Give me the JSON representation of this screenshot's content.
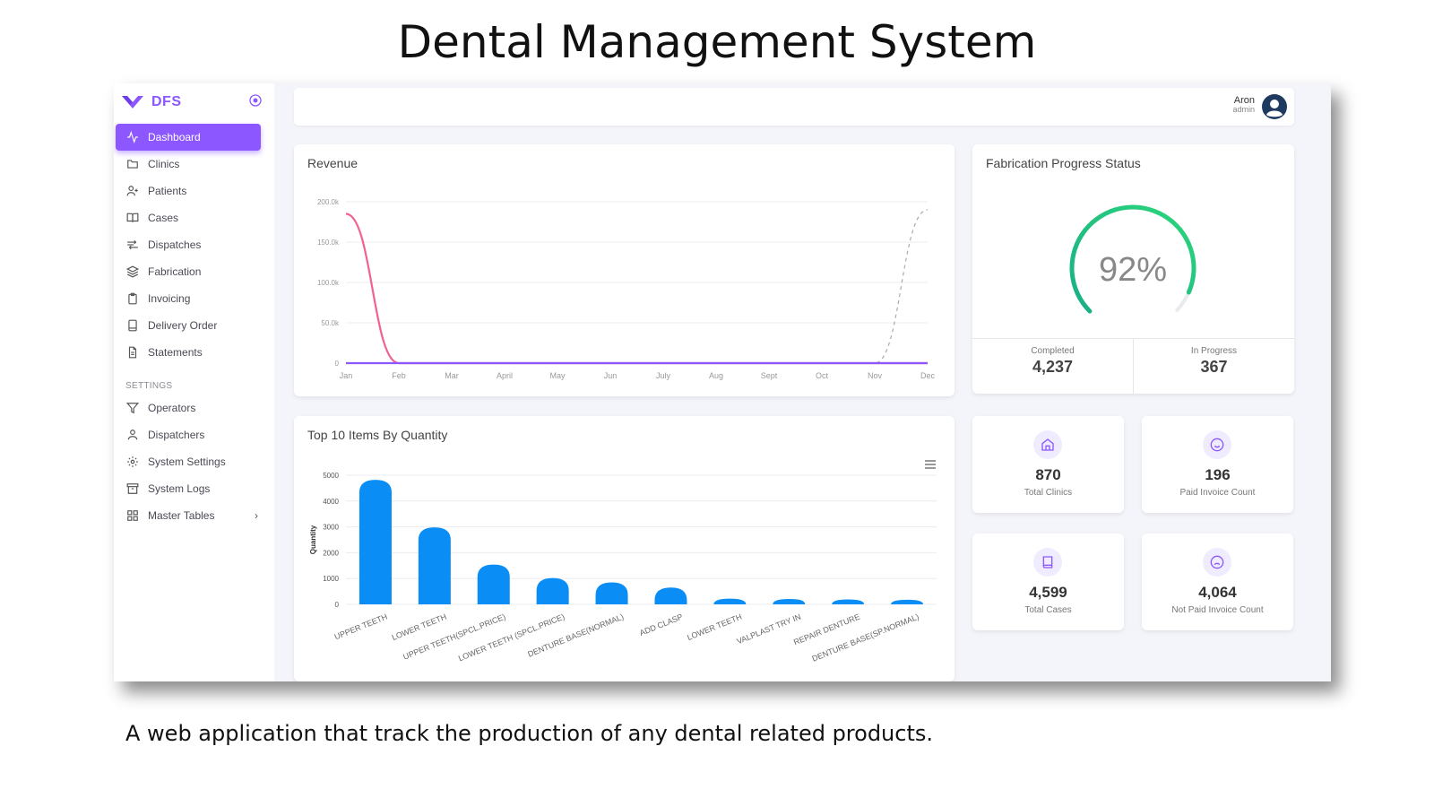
{
  "slide": {
    "title": "Dental Management System",
    "caption": "A web application that track the production of any dental related products."
  },
  "brand": {
    "name": "DFS",
    "accent": "#8c57ff"
  },
  "sidebar": {
    "items": [
      {
        "label": "Dashboard",
        "icon": "activity-icon",
        "active": true
      },
      {
        "label": "Clinics",
        "icon": "folder-icon"
      },
      {
        "label": "Patients",
        "icon": "user-plus-icon"
      },
      {
        "label": "Cases",
        "icon": "book-open-icon"
      },
      {
        "label": "Dispatches",
        "icon": "dispatch-icon"
      },
      {
        "label": "Fabrication",
        "icon": "layers-icon"
      },
      {
        "label": "Invoicing",
        "icon": "clipboard-icon"
      },
      {
        "label": "Delivery Order",
        "icon": "tablet-icon"
      },
      {
        "label": "Statements",
        "icon": "file-text-icon"
      }
    ],
    "settings_header": "SETTINGS",
    "settings_items": [
      {
        "label": "Operators",
        "icon": "filter-icon"
      },
      {
        "label": "Dispatchers",
        "icon": "user-icon"
      },
      {
        "label": "System Settings",
        "icon": "gear-icon"
      },
      {
        "label": "System Logs",
        "icon": "archive-icon"
      },
      {
        "label": "Master Tables",
        "icon": "grid-icon"
      }
    ]
  },
  "topbar": {
    "user_name": "Aron",
    "user_role": "admin"
  },
  "revenue": {
    "title": "Revenue",
    "chart_data": {
      "type": "line",
      "categories": [
        "Jan",
        "Feb",
        "Mar",
        "April",
        "May",
        "Jun",
        "July",
        "Aug",
        "Sept",
        "Oct",
        "Nov",
        "Dec"
      ],
      "y_ticks": [
        "0",
        "50.0k",
        "100.0k",
        "150.0k",
        "200.0k"
      ],
      "ylim": [
        0,
        200000
      ],
      "series": [
        {
          "values": [
            185000,
            0,
            0,
            0,
            0,
            0,
            0,
            0,
            0,
            0,
            0,
            0
          ],
          "color": "#f06292",
          "style": "solid"
        },
        {
          "values": [
            0,
            0,
            0,
            0,
            0,
            0,
            0,
            0,
            0,
            0,
            0,
            190000
          ],
          "color": "#aaaaaa",
          "style": "dashed"
        },
        {
          "values": [
            0,
            0,
            0,
            0,
            0,
            0,
            0,
            0,
            0,
            0,
            0,
            0
          ],
          "color": "#8c57ff",
          "style": "solid"
        }
      ]
    }
  },
  "top_items": {
    "title": "Top 10 Items By Quantity",
    "chart_data": {
      "type": "bar",
      "categories": [
        "UPPER TEETH",
        "LOWER TEETH",
        "UPPER TEETH(SPCL.PRICE)",
        "LOWER TEETH (SPCL.PRICE)",
        "DENTURE BASE(NORMAL)",
        "ADD CLASP",
        "LOWER TEETH",
        "VALPLAST TRY IN",
        "REPAIR DENTURE",
        "DENTURE BASE(SP.NORMAL)"
      ],
      "values": [
        4820,
        2980,
        1540,
        1020,
        850,
        650,
        220,
        210,
        190,
        180
      ],
      "ylabel": "Quantity",
      "y_ticks": [
        "0",
        "1000",
        "2000",
        "3000",
        "4000",
        "5000"
      ],
      "ylim": [
        0,
        5000
      ],
      "color": "#0a8df5"
    }
  },
  "fabrication": {
    "title": "Fabrication Progress Status",
    "percent_label": "92%",
    "percent": 92,
    "completed_label": "Completed",
    "completed_value": "4,237",
    "in_progress_label": "In Progress",
    "in_progress_value": "367"
  },
  "kpis": [
    {
      "value": "870",
      "label": "Total Clinics",
      "icon": "home-icon"
    },
    {
      "value": "196",
      "label": "Paid Invoice Count",
      "icon": "smile-icon"
    },
    {
      "value": "4,599",
      "label": "Total Cases",
      "icon": "book-icon"
    },
    {
      "value": "4,064",
      "label": "Not Paid Invoice Count",
      "icon": "frown-icon"
    }
  ]
}
